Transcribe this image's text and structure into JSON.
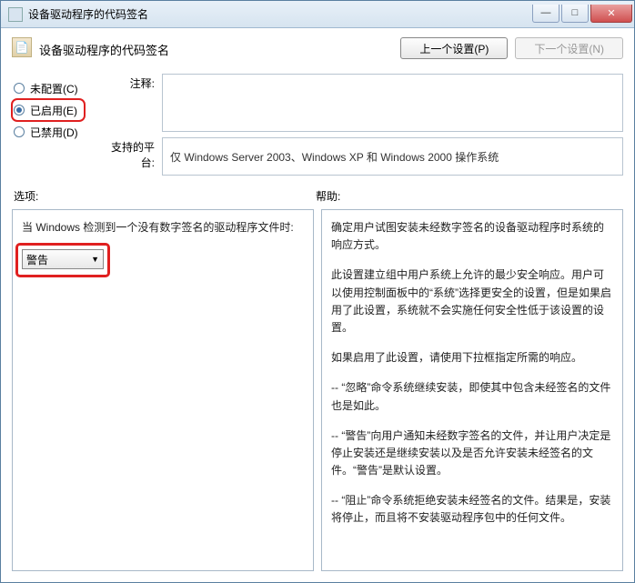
{
  "window": {
    "title": "设备驱动程序的代码签名"
  },
  "header": {
    "title": "设备驱动程序的代码签名",
    "prev_btn": "上一个设置(P)",
    "next_btn": "下一个设置(N)"
  },
  "radios": {
    "not_configured": "未配置(C)",
    "enabled": "已启用(E)",
    "disabled": "已禁用(D)",
    "selected": "enabled"
  },
  "fields": {
    "comment_label": "注释:",
    "comment_value": "",
    "platform_label": "支持的平台:",
    "platform_value": "仅 Windows Server 2003、Windows XP 和 Windows 2000 操作系统"
  },
  "sections": {
    "options_label": "选项:",
    "help_label": "帮助:"
  },
  "options_panel": {
    "prompt": "当 Windows 检测到一个没有数字签名的驱动程序文件时:",
    "combo_value": "警告"
  },
  "help_panel": {
    "p1": "确定用户试图安装未经数字签名的设备驱动程序时系统的响应方式。",
    "p2": "此设置建立组中用户系统上允许的最少安全响应。用户可以使用控制面板中的“系统”选择更安全的设置，但是如果启用了此设置，系统就不会实施任何安全性低于该设置的设置。",
    "p3": "如果启用了此设置，请使用下拉框指定所需的响应。",
    "p4": "-- “忽略”命令系统继续安装，即使其中包含未经签名的文件也是如此。",
    "p5": "-- “警告”向用户通知未经数字签名的文件，并让用户决定是停止安装还是继续安装以及是否允许安装未经签名的文件。“警告”是默认设置。",
    "p6": "-- “阻止”命令系统拒绝安装未经签名的文件。结果是，安装将停止，而且将不安装驱动程序包中的任何文件。"
  }
}
